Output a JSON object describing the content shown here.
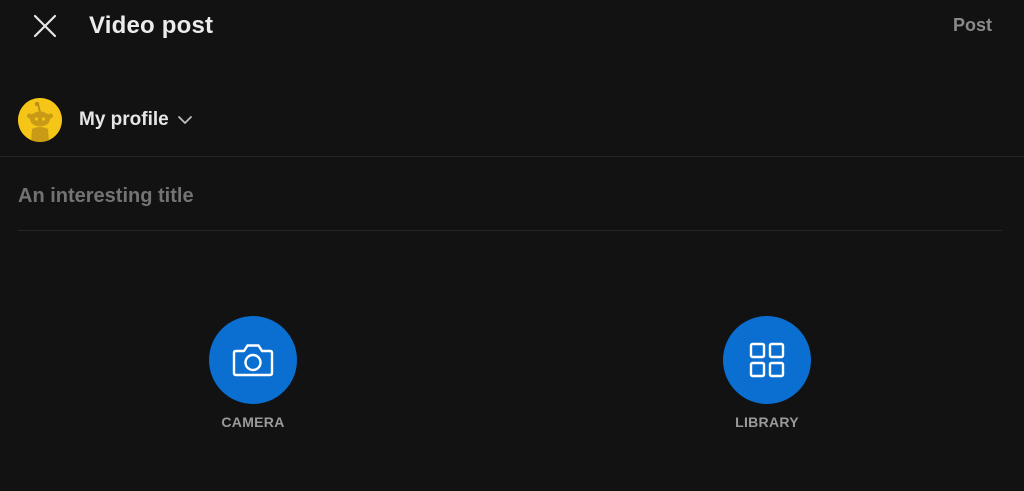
{
  "header": {
    "title": "Video post",
    "post_label": "Post",
    "close_icon": "close-icon"
  },
  "profile": {
    "name": "My profile",
    "avatar_icon": "reddit-snoo-avatar",
    "avatar_color": "#f5c518"
  },
  "form": {
    "title_placeholder": "An interesting title",
    "title_value": ""
  },
  "media": {
    "camera_label": "CAMERA",
    "library_label": "LIBRARY",
    "button_color": "#0a6fd1"
  }
}
